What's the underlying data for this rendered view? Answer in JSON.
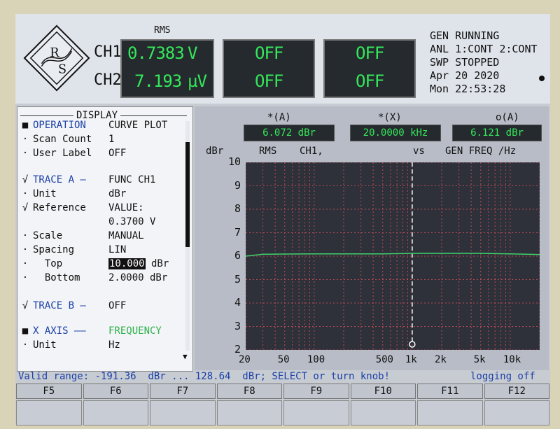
{
  "header": {
    "logo_text": "R&S",
    "rms_label": "RMS",
    "ch1_label": "CH1",
    "ch2_label": "CH2",
    "ch1_value": "0.7383",
    "ch1_unit": "V",
    "ch2_value": "7.193",
    "ch2_unit": "µV",
    "box2_top": "OFF",
    "box2_bottom": "OFF",
    "box3_top": "OFF",
    "box3_bottom": "OFF",
    "status_line1": "GEN RUNNING",
    "status_line2": "ANL 1:CONT 2:CONT",
    "status_line3": "SWP STOPPED",
    "date": "Apr 20 2020",
    "time": "Mon 22:53:28"
  },
  "panel": {
    "title": "DISPLAY",
    "rows": [
      {
        "mark": "■",
        "label": "OPERATION",
        "value": "CURVE PLOT"
      },
      {
        "mark": "·",
        "label": "Scan Count",
        "value": "1"
      },
      {
        "mark": "·",
        "label": "User Label",
        "value": "OFF"
      },
      {
        "mark": "√",
        "label": "TRACE A —",
        "value": "FUNC CH1"
      },
      {
        "mark": "·",
        "label": "Unit",
        "value": "dBr"
      },
      {
        "mark": "√",
        "label": "Reference",
        "value": "VALUE:"
      },
      {
        "mark": "",
        "label": "",
        "value": "0.3700 V"
      },
      {
        "mark": "·",
        "label": "Scale",
        "value": "MANUAL"
      },
      {
        "mark": "·",
        "label": "Spacing",
        "value": "LIN"
      },
      {
        "mark": "·",
        "label": "  Top",
        "value_sel": "10.000",
        "value_rest": " dBr"
      },
      {
        "mark": "·",
        "label": "  Bottom",
        "value": "2.0000 dBr"
      },
      {
        "mark": "√",
        "label": "TRACE B —",
        "value": "OFF"
      },
      {
        "mark": "■",
        "label": "X AXIS ——",
        "value": "FREQUENCY"
      },
      {
        "mark": "·",
        "label": "Unit",
        "value": "Hz"
      }
    ]
  },
  "readouts": {
    "a_label": "*(A)",
    "a_value": "6.072 dBr",
    "x_label": "*(X)",
    "x_value": "20.0000 kHz",
    "o_label": "o(A)",
    "o_value": "6.121 dBr"
  },
  "plot_header": {
    "y_unit": "dBr",
    "rms": "RMS",
    "ch": "CH1,",
    "vs": "vs",
    "gen": "GEN FREQ /Hz"
  },
  "chart_data": {
    "type": "line",
    "xscale": "log",
    "xlim": [
      20,
      20000
    ],
    "ylim": [
      2,
      10
    ],
    "x_ticks": [
      "20",
      "50",
      "100",
      "500",
      "1k",
      "2k",
      "5k",
      "10k"
    ],
    "x_tick_values": [
      20,
      50,
      100,
      500,
      1000,
      2000,
      5000,
      10000
    ],
    "y_ticks": [
      "10",
      "9",
      "8",
      "7",
      "6",
      "5",
      "4",
      "3",
      "2"
    ],
    "cursor_x": 1000,
    "series": [
      {
        "color": "#3fd26a",
        "x": [
          20,
          30,
          50,
          100,
          200,
          500,
          1000,
          2000,
          5000,
          10000,
          20000
        ],
        "y": [
          6.0,
          6.08,
          6.09,
          6.1,
          6.1,
          6.1,
          6.12,
          6.12,
          6.12,
          6.1,
          6.07
        ]
      }
    ]
  },
  "status_bar": {
    "valid": "Valid range: -191.36  dBr ... 128.64  dBr; SELECT or turn knob!",
    "logging": "logging off"
  },
  "fkeys": [
    "F5",
    "F6",
    "F7",
    "F8",
    "F9",
    "F10",
    "F11",
    "F12"
  ]
}
